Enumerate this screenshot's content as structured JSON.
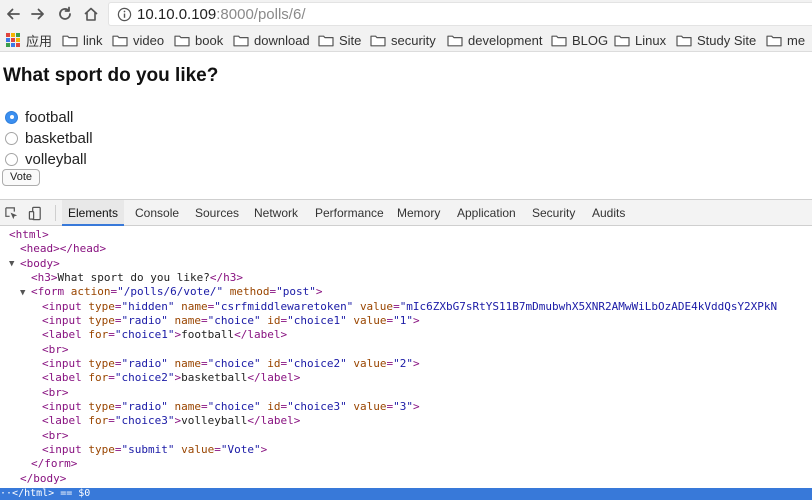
{
  "address_bar": {
    "url_host": "10.10.0.109",
    "url_rest": ":8000/polls/6/"
  },
  "bookmarks": [
    {
      "label": "应用",
      "icon": "apps-icon"
    },
    {
      "label": "link",
      "icon": "folder-icon"
    },
    {
      "label": "video",
      "icon": "folder-icon"
    },
    {
      "label": "book",
      "icon": "folder-icon"
    },
    {
      "label": "download",
      "icon": "folder-icon"
    },
    {
      "label": "Site",
      "icon": "folder-icon"
    },
    {
      "label": "security",
      "icon": "folder-icon"
    },
    {
      "label": "development",
      "icon": "folder-icon"
    },
    {
      "label": "BLOG",
      "icon": "folder-icon"
    },
    {
      "label": "Linux",
      "icon": "folder-icon"
    },
    {
      "label": "Study Site",
      "icon": "folder-icon"
    },
    {
      "label": "me",
      "icon": "folder-icon"
    }
  ],
  "page": {
    "title": "What sport do you like?",
    "choices": [
      {
        "label": "football",
        "checked": true
      },
      {
        "label": "basketball",
        "checked": false
      },
      {
        "label": "volleyball",
        "checked": false
      }
    ],
    "vote_label": "Vote"
  },
  "devtools": {
    "tabs": [
      "Elements",
      "Console",
      "Sources",
      "Network",
      "Performance",
      "Memory",
      "Application",
      "Security",
      "Audits"
    ],
    "active_tab": "Elements",
    "dom": {
      "html_open": "html",
      "head_open": "head",
      "head_close": "/head",
      "body_open": "body",
      "h3_open": "h3",
      "h3_text": "What sport do you like?",
      "h3_close": "/h3",
      "form_open": "form",
      "form_action_name": "action",
      "form_action_value": "\"/polls/6/vote/\"",
      "form_method_name": "method",
      "form_method_value": "\"post\"",
      "input": "input",
      "label": "label",
      "br": "br",
      "type_attr": "type",
      "name_attr": "name",
      "id_attr": "id",
      "value_attr": "value",
      "for_attr": "for",
      "hidden_value": "\"hidden\"",
      "csrf_name_value": "\"csrfmiddlewaretoken\"",
      "csrf_token_value": "\"mIc6ZXbG7sRtYS11B7mDmubwhX5XNR2AMwWiLbOzADE4kVddQsY2XPkN",
      "radio_value": "\"radio\"",
      "choice_value": "\"choice\"",
      "choice1": "\"choice1\"",
      "choice2": "\"choice2\"",
      "choice3": "\"choice3\"",
      "v1": "\"1\"",
      "v2": "\"2\"",
      "v3": "\"3\"",
      "label1_text": "football",
      "label2_text": "basketball",
      "label3_text": "volleyball",
      "label_close": "/label",
      "submit_value": "\"submit\"",
      "vote_value": "\"Vote\"",
      "form_close": "/form",
      "body_close": "/body",
      "html_close": "/html"
    },
    "breadcrumb": "/html> == $0"
  },
  "colors": {
    "accent": "#3879d9",
    "radio_checked": "#3b8ff0",
    "tag": "#881280",
    "attr_name": "#994500",
    "attr_value": "#1a1aa6"
  }
}
